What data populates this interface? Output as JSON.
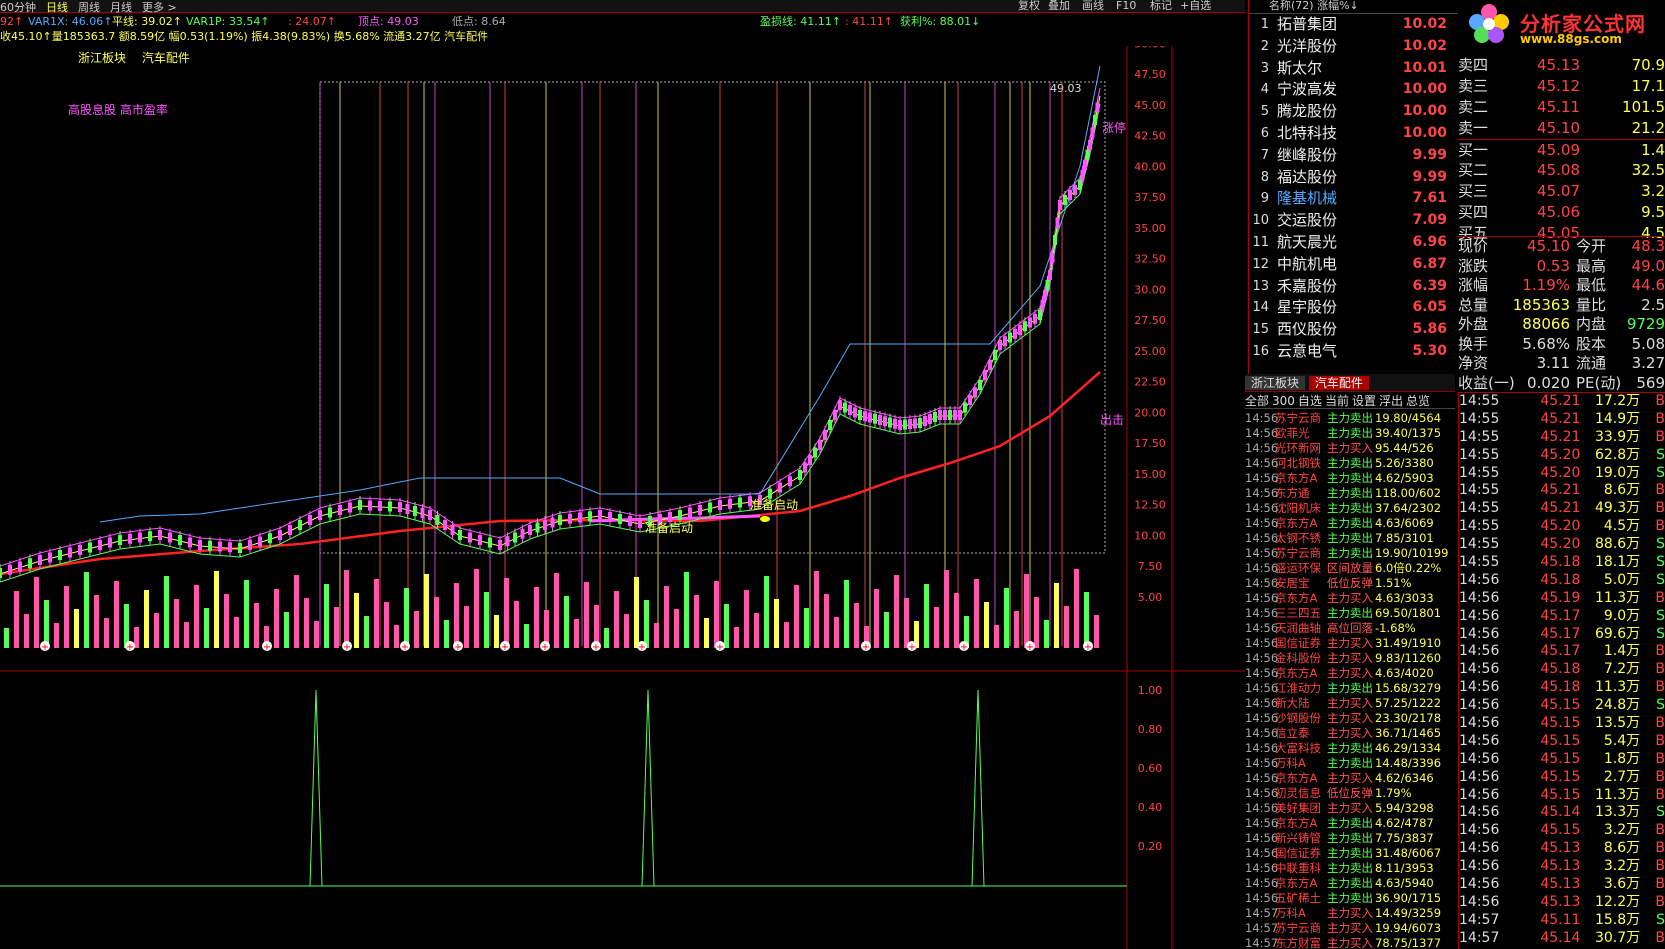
{
  "toolbar": {
    "periods": [
      "60分钟",
      "日线",
      "周线",
      "月线",
      "更多 >"
    ],
    "active": "日线",
    "right": [
      "复权",
      "叠加",
      "画线",
      "F10",
      "标记",
      "+自选"
    ]
  },
  "indicators_row1": [
    {
      "text": "92↑",
      "color": "#ff4444"
    },
    {
      "text": "VAR1X: 46.06↑",
      "color": "#55aaff"
    },
    {
      "text": "平线: 39.02↑",
      "color": "#ffff55"
    },
    {
      "text": "VAR1P: 33.54↑",
      "color": "#55ff55"
    },
    {
      "text": ": 24.07↑",
      "color": "#ff4444"
    },
    {
      "text": "顶点: 49.03",
      "color": "#ff55ff"
    },
    {
      "text": "低点: 8.64",
      "color": "#aaaaaa"
    },
    {
      "text": "盈损线: 41.11↑",
      "color": "#55ff55"
    },
    {
      "text": ": 41.11↑",
      "color": "#ff4444"
    },
    {
      "text": "获利%: 88.01↓",
      "color": "#55ff55"
    }
  ],
  "indicators_row2": "收45.10↑量185363.7 额8.59亿 幅0.53(1.19%) 振4.38(9.83%) 换5.68% 流通3.27亿 汽车配件",
  "sectors": [
    "浙江板块",
    "汽车配件"
  ],
  "hint": "高股息股 高市盈率",
  "price_axis": [
    "50.00",
    "47.50",
    "45.00",
    "42.50",
    "40.00",
    "37.50",
    "35.00",
    "32.50",
    "30.00",
    "27.50",
    "25.00",
    "22.50",
    "20.00",
    "17.50",
    "15.00",
    "12.50",
    "10.00",
    "7.50",
    "5.00"
  ],
  "osc_axis": [
    "1.00",
    "0.80",
    "0.60",
    "0.40",
    "0.20"
  ],
  "chart_labels": {
    "peak": "49.03",
    "exit": "出击",
    "prep1": "准备启动",
    "prep2": "准备启动",
    "limit_up": "涨停"
  },
  "rank": {
    "header": "名称(72)   涨幅%↓",
    "rows": [
      {
        "no": "1",
        "name": "拓普集团",
        "pct": "10.02"
      },
      {
        "no": "2",
        "name": "光洋股份",
        "pct": "10.02"
      },
      {
        "no": "3",
        "name": "斯太尔",
        "pct": "10.01"
      },
      {
        "no": "4",
        "name": "宁波高发",
        "pct": "10.00"
      },
      {
        "no": "5",
        "name": "腾龙股份",
        "pct": "10.00"
      },
      {
        "no": "6",
        "name": "北特科技",
        "pct": "10.00"
      },
      {
        "no": "7",
        "name": "继峰股份",
        "pct": "9.99"
      },
      {
        "no": "8",
        "name": "福达股份",
        "pct": "9.99"
      },
      {
        "no": "9",
        "name": "隆基机械",
        "pct": "7.61"
      },
      {
        "no": "10",
        "name": "交运股份",
        "pct": "7.09"
      },
      {
        "no": "11",
        "name": "航天晨光",
        "pct": "6.96"
      },
      {
        "no": "12",
        "name": "中航机电",
        "pct": "6.87"
      },
      {
        "no": "13",
        "name": "禾嘉股份",
        "pct": "6.39"
      },
      {
        "no": "14",
        "name": "星宇股份",
        "pct": "6.05"
      },
      {
        "no": "15",
        "name": "西仪股份",
        "pct": "5.86"
      },
      {
        "no": "16",
        "name": "云意电气",
        "pct": "5.30"
      }
    ]
  },
  "tabs": [
    "浙江板块",
    "汽车配件"
  ],
  "filters": [
    "全部",
    "300",
    "自选",
    "当前",
    "设置",
    "浮出",
    "总览"
  ],
  "radar": [
    [
      "14:56",
      "苏宁云商",
      "主力卖出",
      "19.80/4564"
    ],
    [
      "14:56",
      "欧菲光",
      "主力卖出",
      "39.40/1375"
    ],
    [
      "14:56",
      "光环新网",
      "主力买入",
      "95.44/526"
    ],
    [
      "14:56",
      "河北钢铁",
      "主力卖出",
      "5.26/3380"
    ],
    [
      "14:56",
      "京东方A",
      "主力卖出",
      "4.62/5903"
    ],
    [
      "14:56",
      "东方通",
      "主力卖出",
      "118.00/602"
    ],
    [
      "14:56",
      "沈阳机床",
      "主力卖出",
      "37.64/2302"
    ],
    [
      "14:56",
      "京东方A",
      "主力卖出",
      "4.63/6069"
    ],
    [
      "14:56",
      "太钢不锈",
      "主力卖出",
      "7.85/3101"
    ],
    [
      "14:56",
      "苏宁云商",
      "主力卖出",
      "19.90/10199"
    ],
    [
      "14:56",
      "盛运环保",
      "区间放量",
      "6.0倍0.22%"
    ],
    [
      "14:56",
      "安居宝",
      "低位反弹",
      "1.51%"
    ],
    [
      "14:56",
      "京东方A",
      "主力买入",
      "4.63/3033"
    ],
    [
      "14:56",
      "三三四五",
      "主力卖出",
      "69.50/1801"
    ],
    [
      "14:56",
      "天润曲轴",
      "高位回落",
      "-1.68%"
    ],
    [
      "14:56",
      "国信证券",
      "主力买入",
      "31.49/1910"
    ],
    [
      "14:56",
      "金科股份",
      "主力买入",
      "9.83/11260"
    ],
    [
      "14:56",
      "京东方A",
      "主力买入",
      "4.63/4020"
    ],
    [
      "14:56",
      "江淮动力",
      "主力卖出",
      "15.68/3279"
    ],
    [
      "14:56",
      "新大陆",
      "主力买入",
      "57.25/1222"
    ],
    [
      "14:56",
      "沙钢股份",
      "主力买入",
      "23.30/2178"
    ],
    [
      "14:56",
      "信立泰",
      "主力买入",
      "36.71/1465"
    ],
    [
      "14:56",
      "大富科技",
      "主力卖出",
      "46.29/1334"
    ],
    [
      "14:56",
      "万科A",
      "主力卖出",
      "14.48/3396"
    ],
    [
      "14:56",
      "京东方A",
      "主力买入",
      "4.62/6346"
    ],
    [
      "14:56",
      "初灵信息",
      "低位反弹",
      "1.79%"
    ],
    [
      "14:56",
      "美好集团",
      "主力买入",
      "5.94/3298"
    ],
    [
      "14:56",
      "京东方A",
      "主力卖出",
      "4.62/4787"
    ],
    [
      "14:56",
      "新兴铸管",
      "主力卖出",
      "7.75/3837"
    ],
    [
      "14:56",
      "国信证券",
      "主力卖出",
      "31.48/6067"
    ],
    [
      "14:56",
      "中联重科",
      "主力卖出",
      "8.11/3953"
    ],
    [
      "14:56",
      "京东方A",
      "主力卖出",
      "4.63/5940"
    ],
    [
      "14:56",
      "五矿稀土",
      "主力卖出",
      "36.90/1715"
    ],
    [
      "14:57",
      "万科A",
      "主力买入",
      "14.49/3259"
    ],
    [
      "14:57",
      "苏宁云商",
      "主力买入",
      "19.94/6073"
    ],
    [
      "14:57",
      "东方财富",
      "主力买入",
      "78.75/1377"
    ]
  ],
  "logo": {
    "title": "分析家公式网",
    "url": "www.88gs.com"
  },
  "orderbook": [
    {
      "label": "卖四",
      "price": "45.13",
      "vol": "70.9"
    },
    {
      "label": "卖三",
      "price": "45.12",
      "vol": "17.1"
    },
    {
      "label": "卖二",
      "price": "45.11",
      "vol": "101.5"
    },
    {
      "label": "卖一",
      "price": "45.10",
      "vol": "21.2"
    },
    {
      "label": "买一",
      "price": "45.09",
      "vol": "1.4"
    },
    {
      "label": "买二",
      "price": "45.08",
      "vol": "32.5"
    },
    {
      "label": "买三",
      "price": "45.07",
      "vol": "3.2"
    },
    {
      "label": "买四",
      "price": "45.06",
      "vol": "9.5"
    },
    {
      "label": "买五",
      "price": "45.05",
      "vol": "4.5"
    }
  ],
  "stats": [
    {
      "a": "现价",
      "b": "45.10",
      "c": "今开",
      "d": "48.3"
    },
    {
      "a": "涨跌",
      "b": "0.53",
      "c": "最高",
      "d": "49.0"
    },
    {
      "a": "涨幅",
      "b": "1.19%",
      "c": "最低",
      "d": "44.6"
    },
    {
      "a": "总量",
      "b": "185363",
      "c": "量比",
      "d": "2.5"
    },
    {
      "a": "外盘",
      "b": "88066",
      "c": "内盘",
      "d": "9729"
    },
    {
      "a": "换手",
      "b": "5.68%",
      "c": "股本",
      "d": "5.08"
    },
    {
      "a": "净资",
      "b": "3.11",
      "c": "流通",
      "d": "3.27"
    },
    {
      "a": "收益(一)",
      "b": "0.020",
      "c": "PE(动)",
      "d": "569"
    }
  ],
  "ticks": [
    [
      "14:55",
      "45.21",
      "17.2万",
      "B"
    ],
    [
      "14:55",
      "45.21",
      "14.9万",
      "B"
    ],
    [
      "14:55",
      "45.21",
      "33.9万",
      "B"
    ],
    [
      "14:55",
      "45.20",
      "62.8万",
      "S"
    ],
    [
      "14:55",
      "45.20",
      "19.0万",
      "S"
    ],
    [
      "14:55",
      "45.21",
      "8.6万",
      "B"
    ],
    [
      "14:55",
      "45.21",
      "49.3万",
      "B"
    ],
    [
      "14:55",
      "45.20",
      "4.5万",
      "B"
    ],
    [
      "14:55",
      "45.20",
      "88.6万",
      "S"
    ],
    [
      "14:55",
      "45.18",
      "18.1万",
      "S"
    ],
    [
      "14:56",
      "45.18",
      "5.0万",
      "S"
    ],
    [
      "14:56",
      "45.19",
      "11.3万",
      "B"
    ],
    [
      "14:56",
      "45.17",
      "9.0万",
      "S"
    ],
    [
      "14:56",
      "45.17",
      "69.6万",
      "S"
    ],
    [
      "14:56",
      "45.17",
      "1.4万",
      "B"
    ],
    [
      "14:56",
      "45.18",
      "7.2万",
      "B"
    ],
    [
      "14:56",
      "45.18",
      "11.3万",
      "B"
    ],
    [
      "14:56",
      "45.15",
      "24.8万",
      "S"
    ],
    [
      "14:56",
      "45.15",
      "13.5万",
      "B"
    ],
    [
      "14:56",
      "45.15",
      "5.4万",
      "B"
    ],
    [
      "14:56",
      "45.15",
      "1.8万",
      "B"
    ],
    [
      "14:56",
      "45.15",
      "2.7万",
      "B"
    ],
    [
      "14:56",
      "45.15",
      "11.3万",
      "B"
    ],
    [
      "14:56",
      "45.14",
      "13.3万",
      "S"
    ],
    [
      "14:56",
      "45.15",
      "3.2万",
      "B"
    ],
    [
      "14:56",
      "45.13",
      "8.6万",
      "B"
    ],
    [
      "14:56",
      "45.13",
      "3.2万",
      "B"
    ],
    [
      "14:56",
      "45.13",
      "3.6万",
      "B"
    ],
    [
      "14:56",
      "45.13",
      "12.2万",
      "B"
    ],
    [
      "14:57",
      "45.11",
      "15.8万",
      "S"
    ],
    [
      "14:57",
      "45.14",
      "30.7万",
      "B"
    ]
  ],
  "colors": {
    "up": "#ff4444",
    "down": "#55ff55",
    "yellow": "#ffff55",
    "magenta": "#ff55ff",
    "border": "#aa0000"
  }
}
